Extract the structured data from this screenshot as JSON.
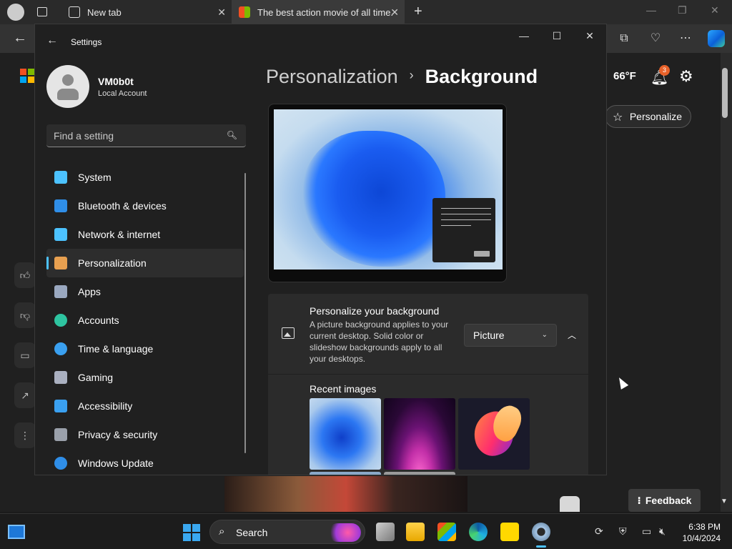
{
  "browser": {
    "tabs": [
      {
        "label": "New tab"
      },
      {
        "label": "The best action movie of all time."
      }
    ],
    "weather": "66°F",
    "notification_count": "3",
    "personalize_label": "Personalize",
    "feedback_label": "Feedback"
  },
  "settings": {
    "title": "Settings",
    "profile": {
      "name": "VM0b0t",
      "account_type": "Local Account"
    },
    "search": {
      "placeholder": "Find a setting"
    },
    "nav": [
      {
        "label": "System",
        "icon": "system-icon",
        "color": "#4cc2ff"
      },
      {
        "label": "Bluetooth & devices",
        "icon": "bluetooth-icon",
        "color": "#2f8ee8"
      },
      {
        "label": "Network & internet",
        "icon": "wifi-icon",
        "color": "#4cc2ff"
      },
      {
        "label": "Personalization",
        "icon": "brush-icon",
        "color": "#e8a050",
        "active": true
      },
      {
        "label": "Apps",
        "icon": "apps-icon",
        "color": "#9aa8c0"
      },
      {
        "label": "Accounts",
        "icon": "person-icon",
        "color": "#2ec4a0"
      },
      {
        "label": "Time & language",
        "icon": "clock-globe-icon",
        "color": "#3aa0f0"
      },
      {
        "label": "Gaming",
        "icon": "gamepad-icon",
        "color": "#aab0c0"
      },
      {
        "label": "Accessibility",
        "icon": "accessibility-icon",
        "color": "#3aa0f0"
      },
      {
        "label": "Privacy & security",
        "icon": "shield-icon",
        "color": "#9aa0aa"
      },
      {
        "label": "Windows Update",
        "icon": "sync-icon",
        "color": "#2f8ee8"
      }
    ],
    "breadcrumb": {
      "parent": "Personalization",
      "separator": "›",
      "current": "Background"
    },
    "background_card": {
      "title": "Personalize your background",
      "description": "A picture background applies to your current desktop. Solid color or slideshow backgrounds apply to all your desktops.",
      "select_value": "Picture"
    },
    "recent_images_label": "Recent images"
  },
  "taskbar": {
    "search_label": "Search",
    "time": "6:38 PM",
    "date": "10/4/2024"
  },
  "colors": {
    "accent": "#4cc2ff",
    "window_bg": "#202020",
    "card_bg": "#2b2b2b"
  }
}
